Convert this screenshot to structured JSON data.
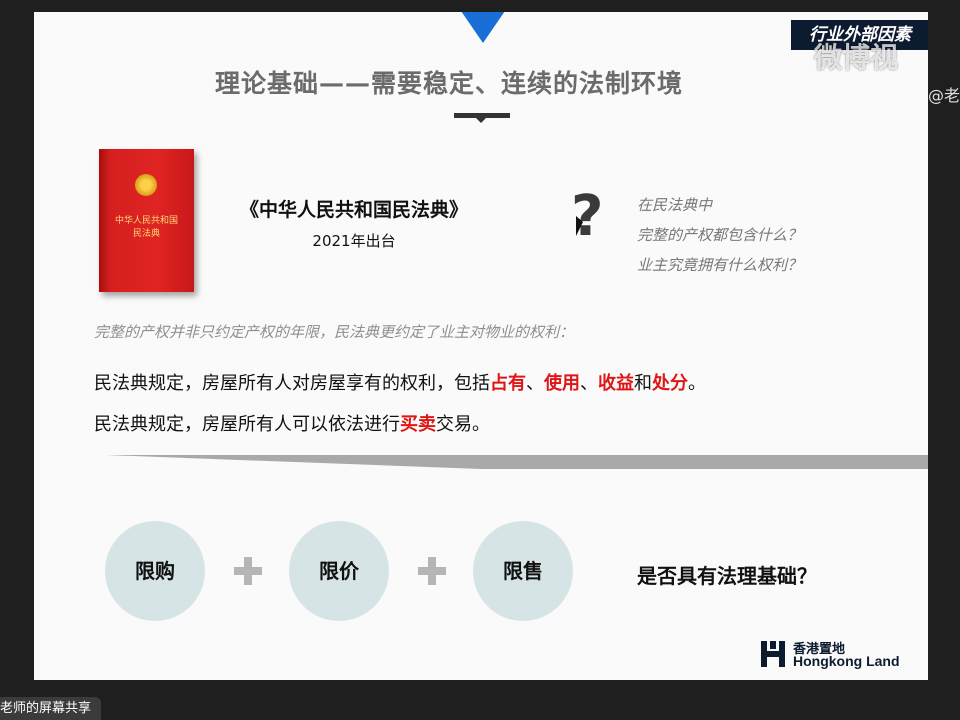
{
  "slide": {
    "corner_tag": "行业外部因素",
    "title": "理论基础——需要稳定、连续的法制环境",
    "book": {
      "cover_title": "中华人民共和国",
      "cover_subtitle": "民法典"
    },
    "law_title": "《中华人民共和国民法典》",
    "law_year": "2021年出台",
    "question_mark": "?",
    "questions": [
      "在民法典中",
      "完整的产权都包含什么？",
      "业主究竟拥有什么权利？"
    ],
    "note": "完整的产权并非只约定产权的年限，民法典更约定了业主对物业的权利：",
    "line1": {
      "prefix": "民法典规定，房屋所有人对房屋享有的权利，包括",
      "hl1": "占有",
      "sep1": "、",
      "hl2": "使用",
      "sep2": "、",
      "hl3": "收益",
      "sep3": "和",
      "hl4": "处分",
      "suffix": "。"
    },
    "line2": {
      "prefix": "民法典规定，房屋所有人可以依法进行",
      "hl": "买卖",
      "suffix": "交易。"
    },
    "circles": [
      "限购",
      "限价",
      "限售"
    ],
    "final_question": "是否具有法理基础？",
    "logo": {
      "cn": "香港置地",
      "en": "Hongkong Land"
    }
  },
  "overlay": {
    "watermark": "微博视",
    "watermark_handle": "@老",
    "share_badge": "老师的屏幕共享"
  },
  "colors": {
    "accent_blue": "#1a6fd6",
    "highlight_red": "#e01515",
    "circle_fill": "#d6e4e6",
    "tag_bg": "#0d1b30"
  }
}
